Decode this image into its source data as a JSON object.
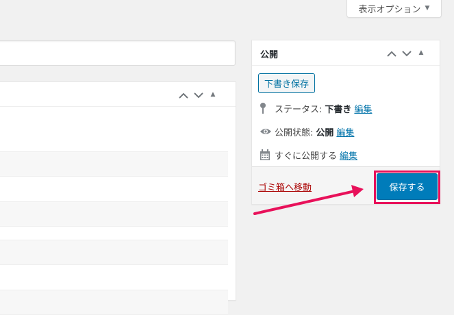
{
  "screen_options": {
    "label": "表示オプション",
    "caret_icon": "caret-down-icon"
  },
  "publish": {
    "title": "公開",
    "save_draft_label": "下書き保存",
    "status_label": "ステータス:",
    "status_value": "下書き",
    "status_edit": "編集",
    "visibility_label": "公開状態:",
    "visibility_value": "公開",
    "visibility_edit": "編集",
    "schedule_label": "すぐに公開する",
    "schedule_edit": "編集",
    "trash_label": "ゴミ箱へ移動",
    "save_button_label": "保存する"
  },
  "colors": {
    "accent": "#007cba",
    "link": "#0073aa",
    "trash": "#aa0000",
    "annotation": "#e8115a"
  }
}
